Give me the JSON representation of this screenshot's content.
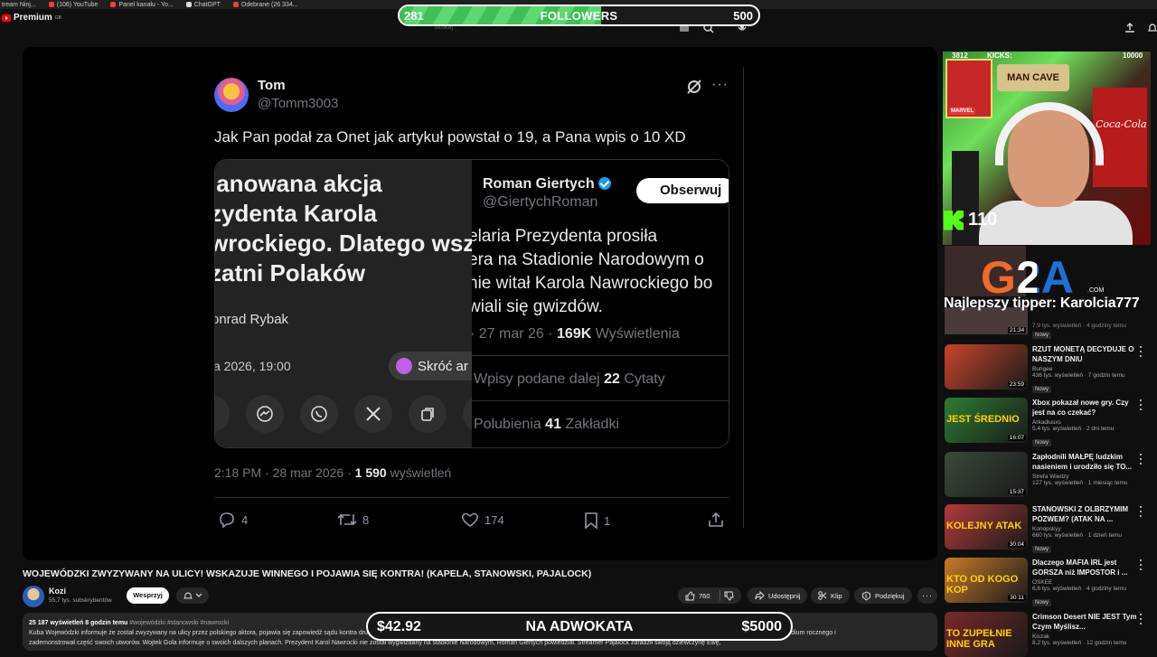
{
  "bookmarks": [
    "tream Ninj...",
    "(106) YouTube",
    "Panel kanału - Yo...",
    "ChatGPT",
    "Odebrane (26 334..."
  ],
  "logo": {
    "text": "Premium",
    "region": "GB"
  },
  "search": {
    "placeholder": "Szukaj"
  },
  "followers": {
    "current": "281",
    "label": "FOLLOWERS",
    "goal": "500",
    "progress": 0.562
  },
  "tweet": {
    "name": "Tom",
    "handle": "@Tomm3003",
    "text": "Jak Pan podał za Onet jak artykuł powstał o 19, a Pana wpis o 10 XD",
    "article": {
      "headline": [
        "lanowana akcja",
        "zydenta Karola",
        "wrockiego. Dlatego wsz",
        "zatni Polaków"
      ],
      "author": "onrad Rybak",
      "date": "a 2026, 19:00",
      "summarize": "Skróć ar"
    },
    "quoted": {
      "name": "Roman Giertych",
      "handle": "@GiertychRoman",
      "follow": "Obserwuj",
      "text": [
        "elaria Prezydenta prosiła",
        "era na Stadionie Narodowym o",
        "nie witał Karola Nawrockiego bo",
        "wiali się gwizdów."
      ],
      "meta_date": "· 27 mar 26 · ",
      "views": "169K",
      "views_label": " Wyświetlenia",
      "reposts_label": "Wpisy podane dalej ",
      "quotes": "22",
      "quotes_label": " Cytaty",
      "likes_label": "Polubienia ",
      "bookmarks": "41",
      "bookmarks_label": " Zakładki"
    },
    "time": "2:18 PM · 28 mar 2026 · ",
    "views": "1 590",
    "views_label": " wyświetleń",
    "replies": "4",
    "retweets": "8",
    "likes": "174",
    "saves": "1"
  },
  "video": {
    "title": "WOJEWÓDZKI ZWYZYWANY NA ULICY! WSKAZUJE WINNEGO I POJAWIA SIĘ KONTRA! (KAPELA, STANOWSKI, PAJALOCK)",
    "channel": "Kozi",
    "subscribers": "55,7 tys. subskrybentów",
    "support": "Wesprzyj",
    "likes": "760",
    "share": "Udostępnij",
    "clip": "Klip",
    "thanks": "Podziękuj",
    "stats": "25 187 wyświetleń  8 godzin temu",
    "tags": "#wojewódzki #stanowski #nawrocki",
    "desc1": "Kuba Wojewódzki informuje że został zwyzywany na ulicy przez polskiego aktora, pojawia się zapowiedź sądu kontra drugiej strony. Krzysztof Stanowski i materiały o Wojewódzkim, Tomasz Karmel odpowiada Wojewódzkiemu. Jak Kapela stworzył 50 tysięcy złotych stypendium rocznego i",
    "desc2": "zademonstrował część swoich utworów. Wojtek Gola informuje o swoich dalszych planach. Prezydent Karol Nawrocki nie został wygwizdany na stadionie Narodowym, Roman Giertych powiedział. Streamer Pajalock zdradził swoją dziewczynę Ewę,"
  },
  "donation": {
    "current": "$42.92",
    "label": "NA ADWOKATA",
    "goal": "$5000",
    "progress": 0.0086
  },
  "stream": {
    "left_count": "3812",
    "kicks_label": "KICKS:",
    "right_count": "10000",
    "sign": "MAN CAVE",
    "poster_tag": "MARVEL",
    "brand_sign": "Coca-Cola",
    "kick_viewers": "110",
    "sponsor": "G2A",
    "sponsor_domain": ".COM",
    "top_tipper": "Najlepszy tipper: Karolcia777"
  },
  "recommendations_top": {
    "meta": "7,9 tys. wyświetleń · 4 godziny temu",
    "duration": "21:34",
    "badge": "Nowy"
  },
  "recommendations": [
    {
      "title": "RZUT MONETĄ DECYDUJE O NASZYM DNIU",
      "channel": "Bungee",
      "meta": "436 tys. wyświetleń · 7 godzin temu",
      "badge": "Nowy",
      "duration": "23:59",
      "caption": "",
      "color": "#c9452b"
    },
    {
      "title": "Xbox pokazał nowe gry. Czy jest na co czekać?",
      "channel": "Arkadiusxs",
      "meta": "5,4 tys. wyświetleń · 2 dni temu",
      "badge": "Nowy",
      "duration": "16:07",
      "caption": "JEST ŚREDNIO",
      "color": "#2e7d32"
    },
    {
      "title": "Zapłodnili MAŁPĘ ludzkim nasieniem i urodziło się TO...",
      "channel": "Strefa Wiedzy",
      "meta": "127 tys. wyświetleń · 1 miesiąc temu",
      "badge": "",
      "duration": "15:37",
      "caption": "",
      "color": "#3a4a3a"
    },
    {
      "title": "STANOWSKI Z OLBRZYMIM POZWEM? (ATAK NA ...",
      "channel": "Konopskyy",
      "meta": "660 tys. wyświetleń · 1 dzień temu",
      "badge": "Nowy",
      "duration": "30:04",
      "caption": "KOLEJNY ATAK",
      "color": "#b23a3a"
    },
    {
      "title": "Dlaczego MAFIA IRL jest GORSZA niż IMPOSTOR i ...",
      "channel": "OSKEE",
      "meta": "6,6 tys. wyświetleń · 4 godziny temu",
      "badge": "Nowy",
      "duration": "30:11",
      "caption": "KTO OD KOGO KOP",
      "color": "#c77b2a"
    },
    {
      "title": "Crimson Desert NIE JEST Tym Czym Myślisz...",
      "channel": "Kiszak",
      "meta": "8,2 tys. wyświetleń · 12 godzin temu",
      "badge": "",
      "duration": "",
      "caption": "TO ZUPEŁNIE INNE GRA",
      "color": "#7a2a2a"
    }
  ]
}
